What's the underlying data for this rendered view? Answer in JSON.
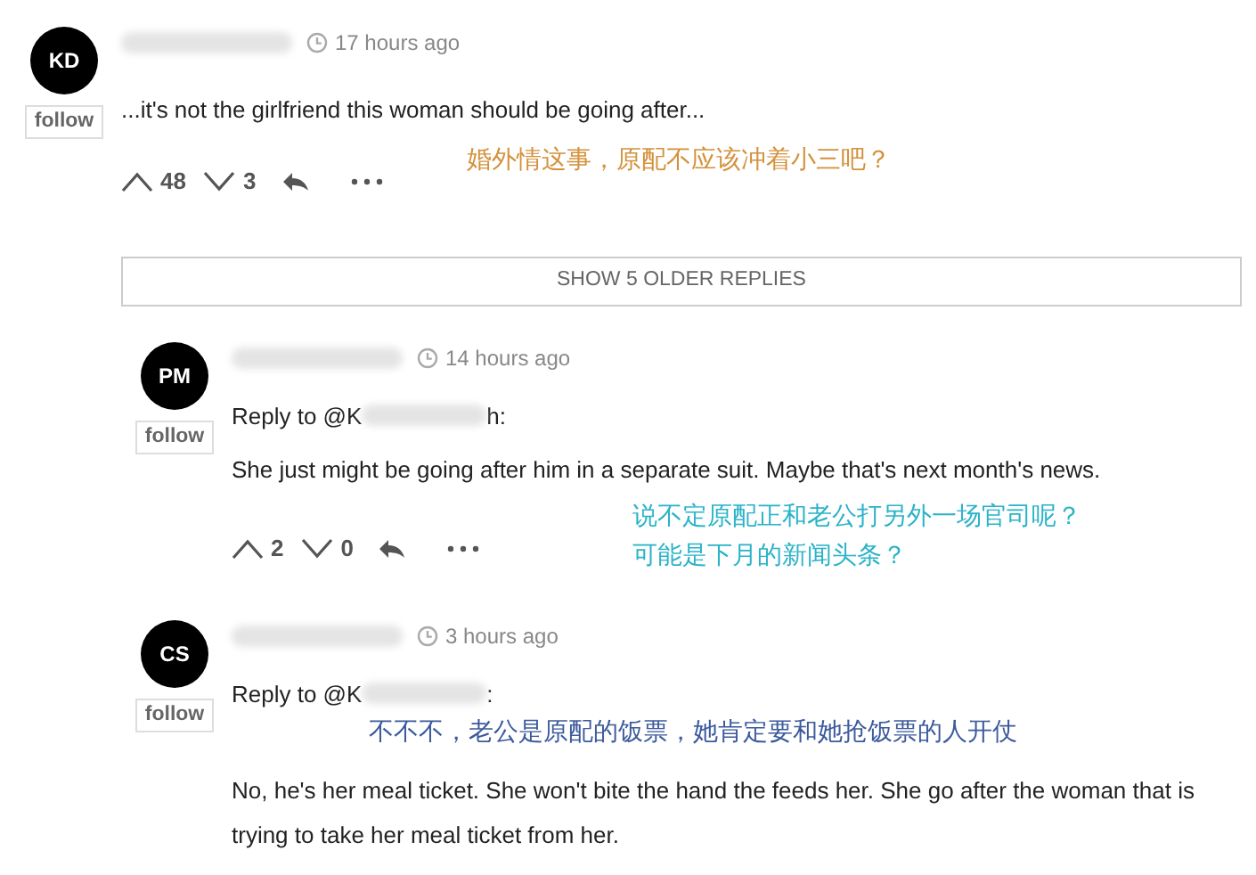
{
  "comments": [
    {
      "initials": "KD",
      "follow": "follow",
      "time": "17 hours ago",
      "body": "...it's not the girlfriend this woman should be going after...",
      "upvotes": "48",
      "downvotes": "3",
      "annotation": {
        "lines": [
          "婚外情这事，原配不应该冲着小三吧？"
        ],
        "color": "#d4913b"
      }
    },
    {
      "kind": "more",
      "label": "SHOW 5 OLDER REPLIES"
    },
    {
      "kind": "reply",
      "initials": "PM",
      "follow": "follow",
      "time": "14 hours ago",
      "reply_prefix": "Reply to @K",
      "reply_suffix": "h:",
      "body": "She just might be going after him in a separate suit. Maybe that's next month's news.",
      "upvotes": "2",
      "downvotes": "0",
      "annotation": {
        "lines": [
          "说不定原配正和老公打另外一场官司呢？",
          "可能是下月的新闻头条？"
        ],
        "color": "#2bb3c9"
      }
    },
    {
      "kind": "reply",
      "initials": "CS",
      "follow": "follow",
      "time": "3 hours ago",
      "reply_prefix": "Reply to @K",
      "reply_suffix": ":",
      "body": "No, he's her meal ticket. She won't bite the hand the feeds her. She go after the woman that is trying to take her meal ticket from her.",
      "annotation": {
        "lines": [
          "不不不，老公是原配的饭票，她肯定要和她抢饭票的人开仗"
        ],
        "color": "#3c5a9c"
      }
    }
  ]
}
